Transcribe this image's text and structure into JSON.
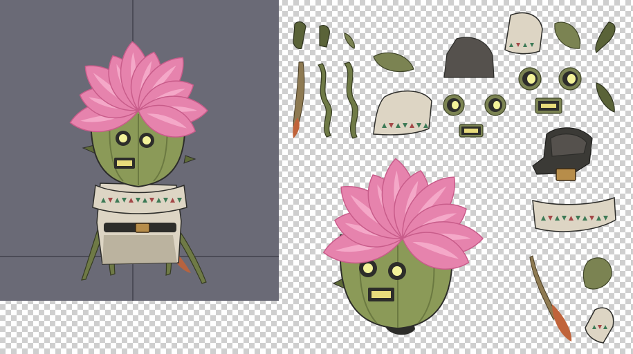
{
  "viewport": {
    "background": "#6a6a76",
    "guide_color": "#2c2c36",
    "preview_subject": "cactus-flower-character-assembled"
  },
  "atlas": {
    "background": "transparent-checkerboard",
    "sprites": [
      "arm-segment-small-1",
      "arm-segment-small-2",
      "leaf-small",
      "twig-long",
      "vine-twist-1",
      "vine-twist-2",
      "leaf-olive",
      "hood-shadow-dark",
      "scarf-piece-small",
      "leaf-olive-2",
      "spike-dark",
      "eye-left-large",
      "eye-right-large",
      "mouth-large",
      "eye-left-small",
      "eye-right-small",
      "mouth-small",
      "scarf-piece-large",
      "hood-dark",
      "belt-buckle",
      "head-with-petals",
      "scarf-band",
      "leaf-round",
      "twig-leaf",
      "scarf-fold"
    ]
  },
  "colors": {
    "petal": "#e683ad",
    "petal_dark": "#c85c8a",
    "petal_light": "#f4a8c8",
    "cactus": "#8b9a58",
    "cactus_dark": "#5e6b38",
    "eye_glow": "#f3f29a",
    "mouth": "#e8dc7c",
    "cloth": "#ddd5c4",
    "cloth_shadow": "#b3aa96",
    "pattern_green": "#3d7a56",
    "pattern_red": "#a44848",
    "dark": "#2d2d2a",
    "hood_gray": "#55514d",
    "olive": "#7b8352",
    "buckle": "#b78d4a",
    "twig": "#8e7a52",
    "twig_tip": "#c0633a"
  }
}
